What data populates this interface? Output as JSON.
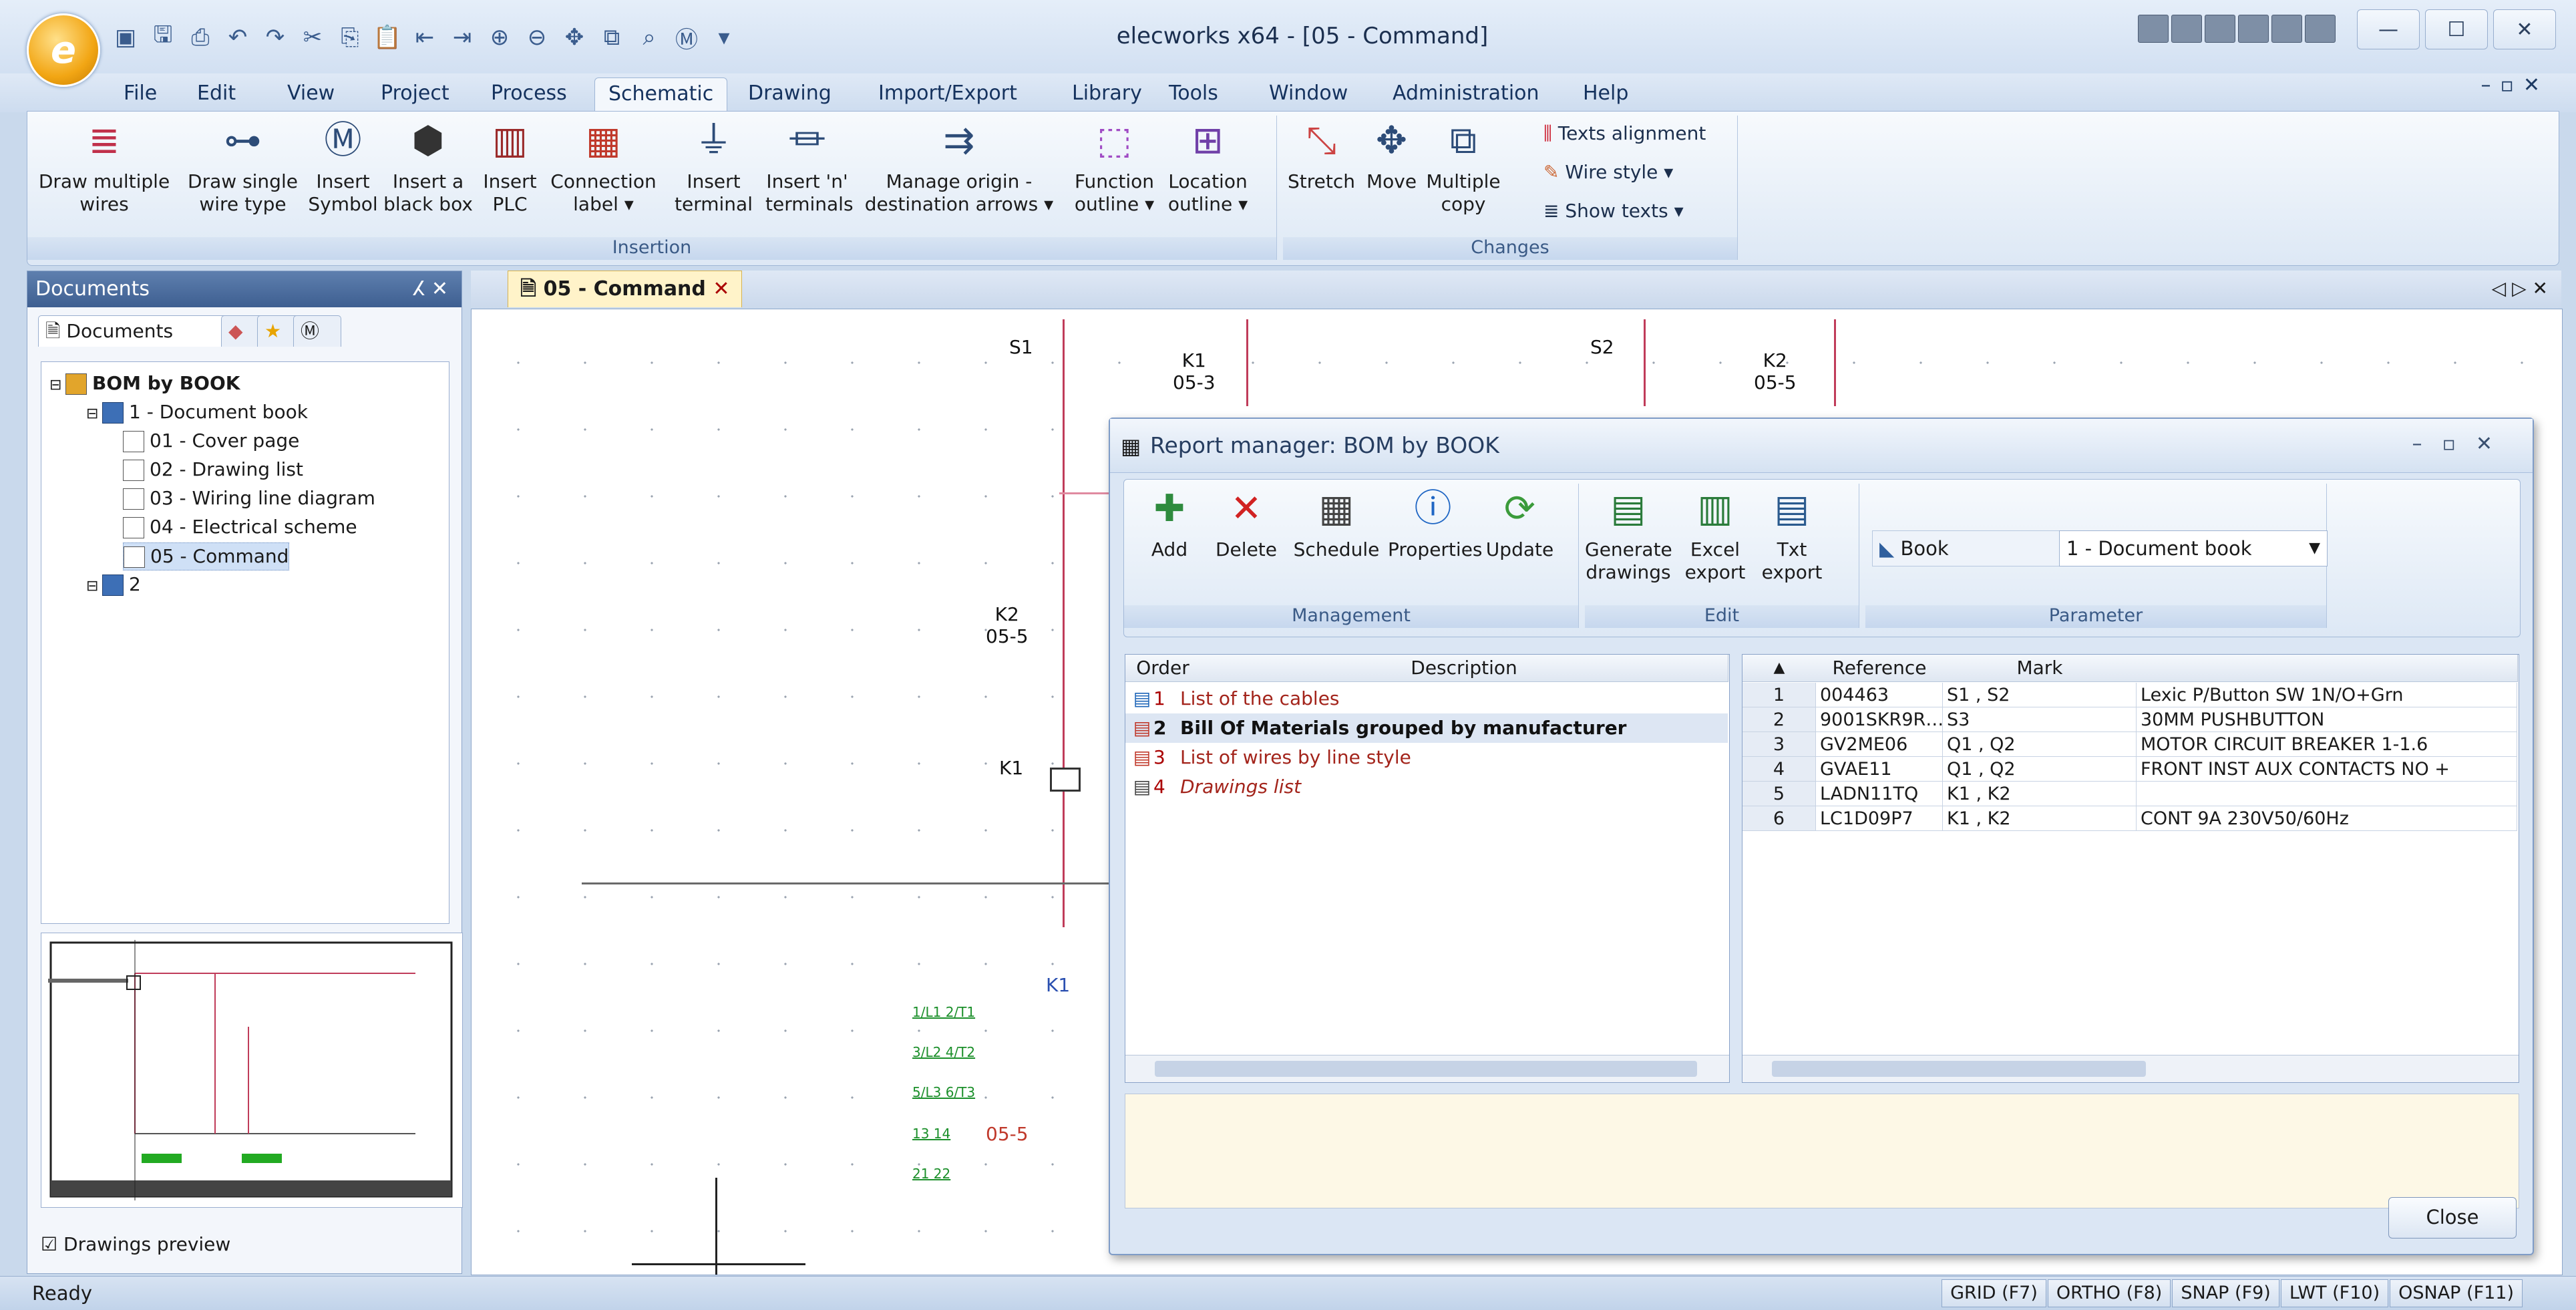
{
  "app": {
    "window_title": "elecworks x64 - [05 - Command]",
    "orb_letter": "e"
  },
  "menu": [
    "File",
    "Edit",
    "View",
    "Project",
    "Process",
    "Schematic",
    "Drawing",
    "Import/Export",
    "Library",
    "Tools",
    "Window",
    "Administration",
    "Help"
  ],
  "menu_active": "Schematic",
  "ribbon": {
    "insertion_group": "Insertion",
    "changes_group": "Changes",
    "buttons": [
      {
        "label": "Draw multiple\nwires",
        "icon": "wires-icon"
      },
      {
        "label": "Draw single\nwire type",
        "icon": "wire-type-icon"
      },
      {
        "label": "Insert\nSymbol",
        "icon": "symbol-icon"
      },
      {
        "label": "Insert a\nblack box",
        "icon": "black-box-icon"
      },
      {
        "label": "Insert\nPLC",
        "icon": "plc-icon"
      },
      {
        "label": "Connection\nlabel ▾",
        "icon": "connection-label-icon"
      },
      {
        "label": "Insert\nterminal",
        "icon": "terminal-icon"
      },
      {
        "label": "Insert 'n'\nterminals",
        "icon": "n-terminals-icon"
      },
      {
        "label": "Manage origin -\ndestination arrows ▾",
        "icon": "arrows-icon"
      },
      {
        "label": "Function\noutline ▾",
        "icon": "function-outline-icon"
      },
      {
        "label": "Location\noutline ▾",
        "icon": "location-outline-icon"
      },
      {
        "label": "Stretch",
        "icon": "stretch-icon"
      },
      {
        "label": "Move",
        "icon": "move-icon"
      },
      {
        "label": "Multiple\ncopy",
        "icon": "multiple-copy-icon"
      }
    ],
    "small_buttons": [
      "Texts alignment",
      "Wire style ▾",
      "Show texts ▾"
    ]
  },
  "documents": {
    "title": "Documents",
    "tab_label": "Documents",
    "tree": [
      {
        "label": "BOM by BOOK",
        "level": 0,
        "bold": true
      },
      {
        "label": "1 - Document book",
        "level": 1
      },
      {
        "label": "01 - Cover page",
        "level": 2
      },
      {
        "label": "02 - Drawing list",
        "level": 2
      },
      {
        "label": "03 - Wiring line diagram",
        "level": 2
      },
      {
        "label": "04 - Electrical scheme",
        "level": 2
      },
      {
        "label": "05 - Command",
        "level": 2,
        "selected": true
      },
      {
        "label": "2",
        "level": 1
      }
    ],
    "preview_label": "Drawings preview"
  },
  "drawing": {
    "tab_label": "05 - Command",
    "labels": [
      "S1",
      "K1\n05-3",
      "S2",
      "K2\n05-5",
      "K2\n05-5",
      "K1",
      "K1",
      "05-5"
    ],
    "green_labels": [
      "1/L1  2/T1",
      "3/L2  4/T2",
      "5/L3  6/T3",
      "13    14",
      "21    22"
    ]
  },
  "report": {
    "title": "Report manager: BOM by BOOK",
    "buttons": [
      {
        "label": "Add",
        "icon": "add-icon"
      },
      {
        "label": "Delete",
        "icon": "delete-icon"
      },
      {
        "label": "Schedule",
        "icon": "schedule-icon"
      },
      {
        "label": "Properties",
        "icon": "properties-icon"
      },
      {
        "label": "Update",
        "icon": "update-icon"
      },
      {
        "label": "Generate\ndrawings",
        "icon": "generate-icon"
      },
      {
        "label": "Excel\nexport",
        "icon": "excel-icon"
      },
      {
        "label": "Txt\nexport",
        "icon": "txt-icon"
      }
    ],
    "groups": [
      "Management",
      "Edit",
      "Parameter"
    ],
    "param_label": "Book",
    "param_value": "1 - Document book",
    "list_headers": [
      "Order",
      "Description"
    ],
    "list": [
      {
        "order": "1",
        "desc": "List of the cables"
      },
      {
        "order": "2",
        "desc": "Bill Of Materials grouped by manufacturer",
        "bold": true
      },
      {
        "order": "3",
        "desc": "List of wires by line style"
      },
      {
        "order": "4",
        "desc": "Drawings list"
      }
    ],
    "grid_headers": [
      "Reference",
      "Mark"
    ],
    "grid": [
      {
        "n": "1",
        "ref": "004463",
        "mark": "S1 , S2",
        "desc": "Lexic P/Button SW 1N/O+Grn"
      },
      {
        "n": "2",
        "ref": "9001SKR9R…",
        "mark": "S3",
        "desc": "30MM PUSHBUTTON"
      },
      {
        "n": "3",
        "ref": "GV2ME06",
        "mark": "Q1 , Q2",
        "desc": "MOTOR CIRCUIT BREAKER  1-1.6"
      },
      {
        "n": "4",
        "ref": "GVAE11",
        "mark": "Q1 , Q2",
        "desc": "FRONT INST AUX CONTACTS NO +"
      },
      {
        "n": "5",
        "ref": "LADN11TQ",
        "mark": "K1 , K2",
        "desc": ""
      },
      {
        "n": "6",
        "ref": "LC1D09P7",
        "mark": "K1 , K2",
        "desc": "CONT 9A 230V50/60Hz"
      }
    ],
    "close_label": "Close"
  },
  "status": {
    "text": "Ready",
    "toggles": [
      "GRID (F7)",
      "ORTHO (F8)",
      "SNAP (F9)",
      "LWT (F10)",
      "OSNAP (F11)"
    ]
  }
}
